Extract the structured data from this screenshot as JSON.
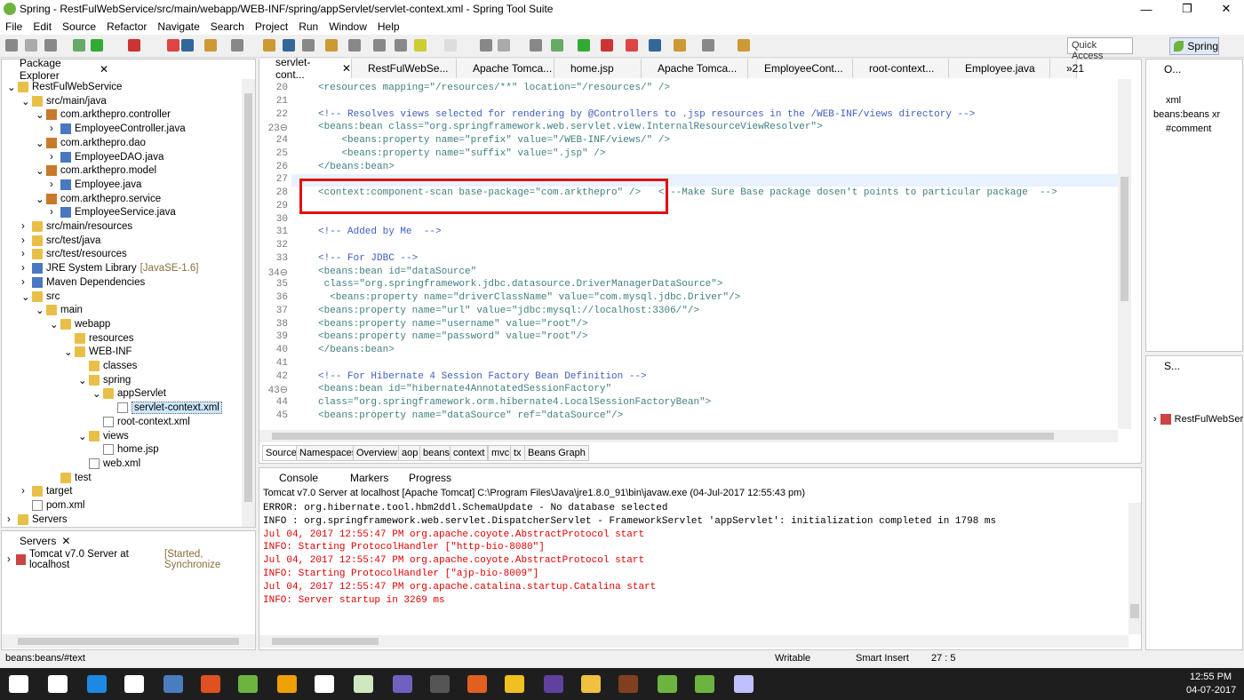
{
  "window": {
    "title": "Spring - RestFulWebService/src/main/webapp/WEB-INF/spring/appServlet/servlet-context.xml - Spring Tool Suite",
    "min": "—",
    "max": "❐",
    "close": "✕"
  },
  "menu": [
    "File",
    "Edit",
    "Source",
    "Refactor",
    "Navigate",
    "Search",
    "Project",
    "Run",
    "Window",
    "Help"
  ],
  "toolbar": {
    "quick_access": "Quick Access",
    "perspective": "Spring"
  },
  "package_explorer": {
    "title": "Package Explorer",
    "items": [
      {
        "label": "RestFulWebService",
        "indent": 0,
        "icon": "fold",
        "tw": "⌄"
      },
      {
        "label": "src/main/java",
        "indent": 1,
        "icon": "fold",
        "tw": "⌄"
      },
      {
        "label": "com.arkthepro.controller",
        "indent": 2,
        "icon": "pkg",
        "tw": "⌄"
      },
      {
        "label": "EmployeeController.java",
        "indent": 3,
        "icon": "jf",
        "tw": "›"
      },
      {
        "label": "com.arkthepro.dao",
        "indent": 2,
        "icon": "pkg",
        "tw": "⌄"
      },
      {
        "label": "EmployeeDAO.java",
        "indent": 3,
        "icon": "jf",
        "tw": "›"
      },
      {
        "label": "com.arkthepro.model",
        "indent": 2,
        "icon": "pkg",
        "tw": "⌄"
      },
      {
        "label": "Employee.java",
        "indent": 3,
        "icon": "jf",
        "tw": "›"
      },
      {
        "label": "com.arkthepro.service",
        "indent": 2,
        "icon": "pkg",
        "tw": "⌄"
      },
      {
        "label": "EmployeeService.java",
        "indent": 3,
        "icon": "jf",
        "tw": "›"
      },
      {
        "label": "src/main/resources",
        "indent": 1,
        "icon": "fold",
        "tw": "›"
      },
      {
        "label": "src/test/java",
        "indent": 1,
        "icon": "fold",
        "tw": "›"
      },
      {
        "label": "src/test/resources",
        "indent": 1,
        "icon": "fold",
        "tw": "›"
      },
      {
        "label": "JRE System Library",
        "extra": "[JavaSE-1.6]",
        "indent": 1,
        "icon": "jf",
        "tw": "›"
      },
      {
        "label": "Maven Dependencies",
        "indent": 1,
        "icon": "jf",
        "tw": "›"
      },
      {
        "label": "src",
        "indent": 1,
        "icon": "fold",
        "tw": "⌄"
      },
      {
        "label": "main",
        "indent": 2,
        "icon": "fold",
        "tw": "⌄"
      },
      {
        "label": "webapp",
        "indent": 3,
        "icon": "fold",
        "tw": "⌄"
      },
      {
        "label": "resources",
        "indent": 4,
        "icon": "fold",
        "tw": ""
      },
      {
        "label": "WEB-INF",
        "indent": 4,
        "icon": "fold",
        "tw": "⌄"
      },
      {
        "label": "classes",
        "indent": 5,
        "icon": "fold",
        "tw": ""
      },
      {
        "label": "spring",
        "indent": 5,
        "icon": "fold",
        "tw": "⌄"
      },
      {
        "label": "appServlet",
        "indent": 6,
        "icon": "fold",
        "tw": "⌄"
      },
      {
        "label": "servlet-context.xml",
        "indent": 7,
        "icon": "xf",
        "tw": "",
        "selected": true
      },
      {
        "label": "root-context.xml",
        "indent": 6,
        "icon": "xf",
        "tw": ""
      },
      {
        "label": "views",
        "indent": 5,
        "icon": "fold",
        "tw": "⌄"
      },
      {
        "label": "home.jsp",
        "indent": 6,
        "icon": "xf",
        "tw": ""
      },
      {
        "label": "web.xml",
        "indent": 5,
        "icon": "xf",
        "tw": ""
      },
      {
        "label": "test",
        "indent": 3,
        "icon": "fold",
        "tw": ""
      },
      {
        "label": "target",
        "indent": 1,
        "icon": "fold",
        "tw": "›"
      },
      {
        "label": "pom.xml",
        "indent": 1,
        "icon": "xf",
        "tw": ""
      },
      {
        "label": "Servers",
        "indent": 0,
        "icon": "fold",
        "tw": "›"
      }
    ]
  },
  "servers_panel": {
    "title": "Servers",
    "entry": "Tomcat v7.0 Server at localhost",
    "status": "[Started, Synchronize"
  },
  "editor_tabs": [
    "servlet-cont...",
    "RestFulWebSe...",
    "Apache Tomca...",
    "home.jsp",
    "Apache Tomca...",
    "EmployeeCont...",
    "root-context...",
    "Employee.java",
    "»21"
  ],
  "editor_lines": [
    {
      "n": "20",
      "t": "<resources mapping=\"/resources/**\" location=\"/resources/\" />"
    },
    {
      "n": "21",
      "t": ""
    },
    {
      "n": "22",
      "t": "<!-- Resolves views selected for rendering by @Controllers to .jsp resources in the /WEB-INF/views directory -->"
    },
    {
      "n": "23⊖",
      "t": "<beans:bean class=\"org.springframework.web.servlet.view.InternalResourceViewResolver\">"
    },
    {
      "n": "24",
      "t": "    <beans:property name=\"prefix\" value=\"/WEB-INF/views/\" />"
    },
    {
      "n": "25",
      "t": "    <beans:property name=\"suffix\" value=\".jsp\" />"
    },
    {
      "n": "26",
      "t": "</beans:bean>"
    },
    {
      "n": "27",
      "t": ""
    },
    {
      "n": "28",
      "t": "<context:component-scan base-package=\"com.arkthepro\" />   <!--Make Sure Base package dosen't points to particular package  -->"
    },
    {
      "n": "29",
      "t": ""
    },
    {
      "n": "30",
      "t": ""
    },
    {
      "n": "31",
      "t": "<!-- Added by Me  -->"
    },
    {
      "n": "32",
      "t": ""
    },
    {
      "n": "33",
      "t": "<!-- For JDBC -->"
    },
    {
      "n": "34⊖",
      "t": "<beans:bean id=\"dataSource\""
    },
    {
      "n": "35",
      "t": " class=\"org.springframework.jdbc.datasource.DriverManagerDataSource\">"
    },
    {
      "n": "36",
      "t": "  <beans:property name=\"driverClassName\" value=\"com.mysql.jdbc.Driver\"/>"
    },
    {
      "n": "37",
      "t": "<beans:property name=\"url\" value=\"jdbc:mysql://localhost:3306/\"/>"
    },
    {
      "n": "38",
      "t": "<beans:property name=\"username\" value=\"root\"/>"
    },
    {
      "n": "39",
      "t": "<beans:property name=\"password\" value=\"root\"/>"
    },
    {
      "n": "40",
      "t": "</beans:bean>"
    },
    {
      "n": "41",
      "t": ""
    },
    {
      "n": "42",
      "t": "<!-- For Hibernate 4 Session Factory Bean Definition -->"
    },
    {
      "n": "43⊖",
      "t": "<beans:bean id=\"hibernate4AnnotatedSessionFactory\""
    },
    {
      "n": "44",
      "t": "class=\"org.springframework.orm.hibernate4.LocalSessionFactoryBean\">"
    },
    {
      "n": "45",
      "t": "<beans:property name=\"dataSource\" ref=\"dataSource\"/>"
    }
  ],
  "bottom_tabs": [
    "Source",
    "Namespaces",
    "Overview",
    "aop",
    "beans",
    "context",
    "mvc",
    "tx",
    "Beans Graph"
  ],
  "console": {
    "tabs": [
      "Console",
      "Markers",
      "Progress"
    ],
    "header": "Tomcat v7.0 Server at localhost [Apache Tomcat] C:\\Program Files\\Java\\jre1.8.0_91\\bin\\javaw.exe (04-Jul-2017 12:55:43 pm)",
    "lines": [
      {
        "t": "ERROR: org.hibernate.tool.hbm2ddl.SchemaUpdate - No database selected",
        "c": "#000"
      },
      {
        "t": "INFO : org.springframework.web.servlet.DispatcherServlet - FrameworkServlet 'appServlet': initialization completed in 1798 ms",
        "c": "#000"
      },
      {
        "t": "Jul 04, 2017 12:55:47 PM org.apache.coyote.AbstractProtocol start",
        "c": "#e00000"
      },
      {
        "t": "INFO: Starting ProtocolHandler [\"http-bio-8080\"]",
        "c": "#e00000"
      },
      {
        "t": "Jul 04, 2017 12:55:47 PM org.apache.coyote.AbstractProtocol start",
        "c": "#e00000"
      },
      {
        "t": "INFO: Starting ProtocolHandler [\"ajp-bio-8009\"]",
        "c": "#e00000"
      },
      {
        "t": "Jul 04, 2017 12:55:47 PM org.apache.catalina.startup.Catalina start",
        "c": "#e00000"
      },
      {
        "t": "INFO: Server startup in 3269 ms",
        "c": "#e00000"
      }
    ]
  },
  "outline": {
    "title": "O...",
    "items": [
      "xml",
      "beans:beans xr",
      "#comment"
    ]
  },
  "servers_right": {
    "title": "S...",
    "item": "RestFulWebSer"
  },
  "status": {
    "path": "beans:beans/#text",
    "mode": "Writable",
    "insert": "Smart Insert",
    "pos": "27 : 5"
  },
  "taskbar": {
    "time": "12:55 PM",
    "date": "04-07-2017"
  }
}
